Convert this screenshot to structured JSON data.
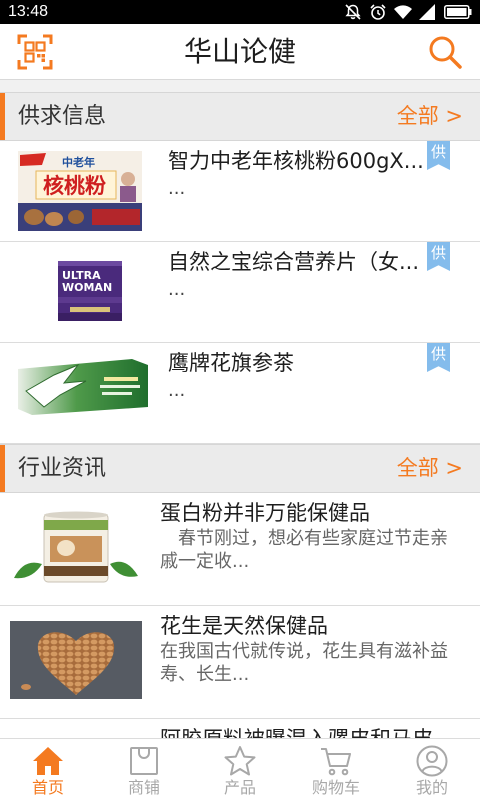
{
  "status_bar": {
    "time": "13:48",
    "icons": [
      "notifications-off-icon",
      "alarm-icon",
      "wifi-icon",
      "signal-icon",
      "battery-icon"
    ]
  },
  "colors": {
    "accent": "#f47a20",
    "badge": "#84bcec",
    "section_bg": "#ebebeb",
    "nav_inactive": "#a8a8a8"
  },
  "header": {
    "title": "华山论健",
    "left_icon": "qr-code-icon",
    "right_icon": "search-icon"
  },
  "supply_section": {
    "title": "供求信息",
    "more_label": "全部 >",
    "items": [
      {
        "title": "智力中老年核桃粉600gX...",
        "desc": "...",
        "badge": "供",
        "image_text": [
          "中老年",
          "核桃粉"
        ]
      },
      {
        "title": "自然之宝综合营养片（女...",
        "desc": "...",
        "badge": "供",
        "image_text": [
          "ULTRA",
          "WOMAN"
        ]
      },
      {
        "title": "鹰牌花旗参茶",
        "desc": "...",
        "badge": "供"
      }
    ]
  },
  "news_section": {
    "title": "行业资讯",
    "more_label": "全部 >",
    "items": [
      {
        "title": "蛋白粉并非万能保健品",
        "desc": "　春节刚过，想必有些家庭过节走亲戚一定收..."
      },
      {
        "title": "花生是天然保健品",
        "desc": "在我国古代就传说，花生具有滋补益寿、长生..."
      },
      {
        "title": "阿胶原料被曝混入骡皮和马皮"
      }
    ]
  },
  "bottom_nav": {
    "items": [
      {
        "label": "首页",
        "icon": "home-icon",
        "active": true
      },
      {
        "label": "商铺",
        "icon": "shop-icon",
        "active": false
      },
      {
        "label": "产品",
        "icon": "star-icon",
        "active": false
      },
      {
        "label": "购物车",
        "icon": "cart-icon",
        "active": false
      },
      {
        "label": "我的",
        "icon": "user-icon",
        "active": false
      }
    ]
  }
}
